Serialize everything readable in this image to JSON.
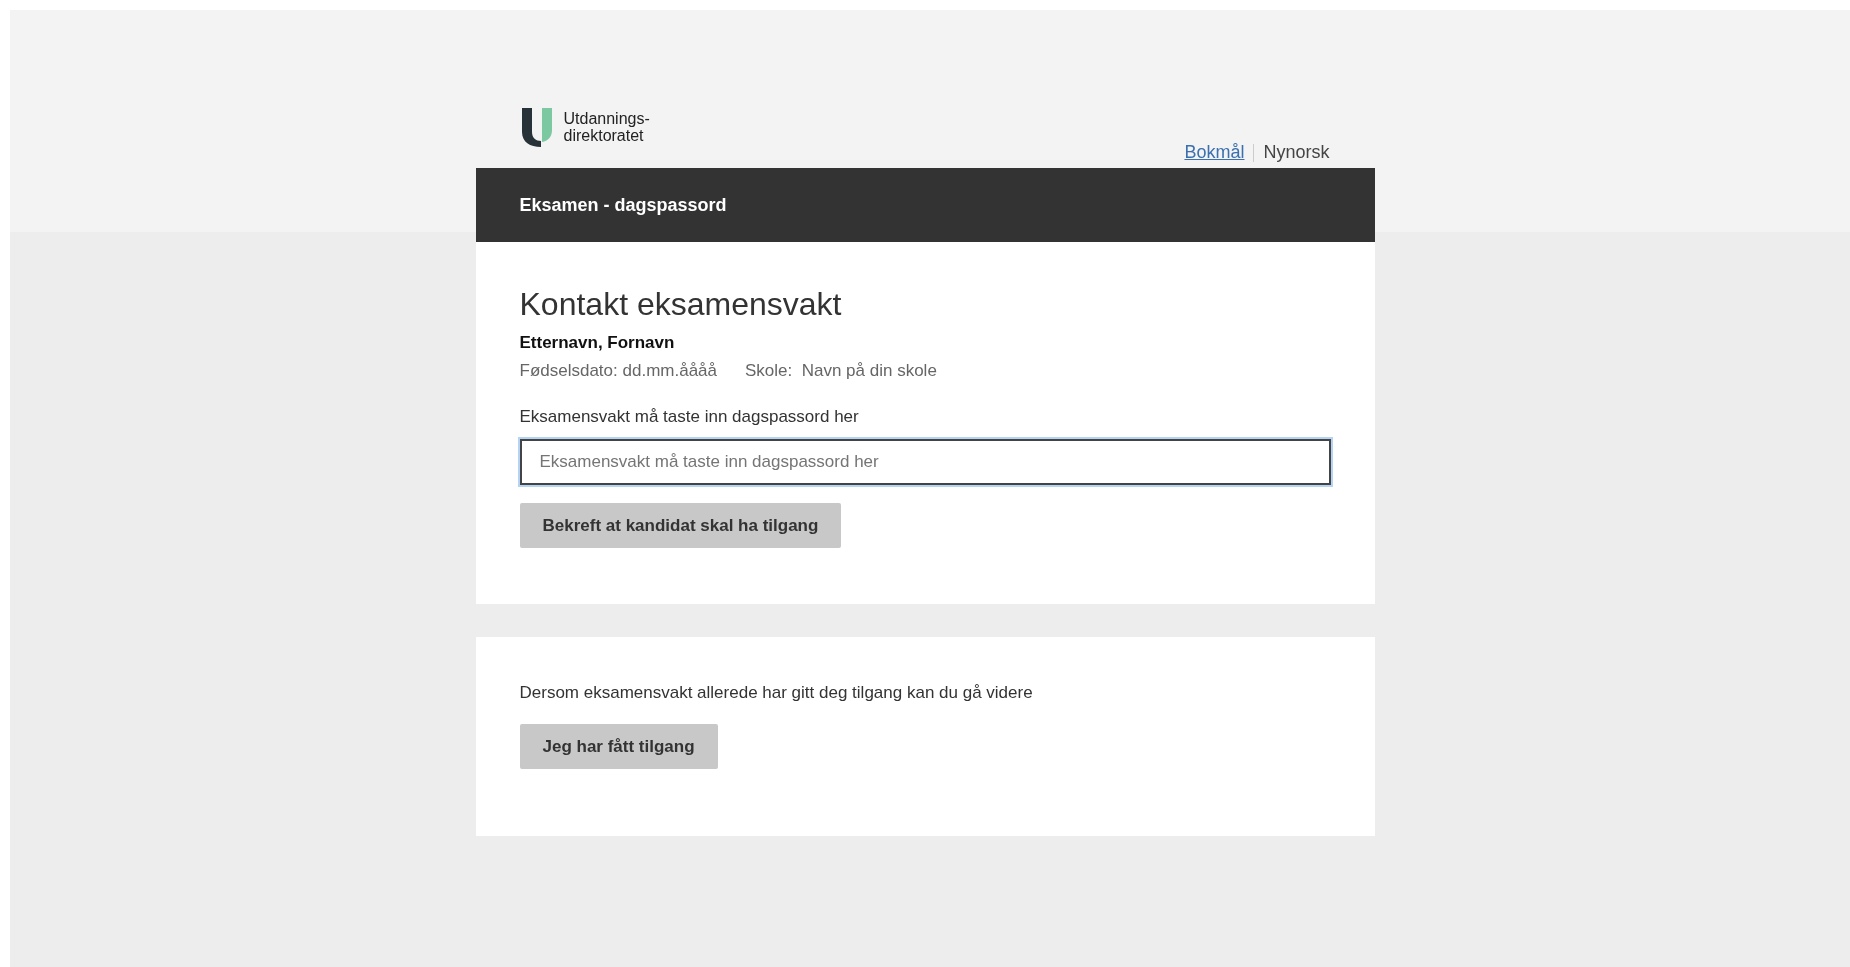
{
  "logo": {
    "line_1": "Utdannings-",
    "line_2": "direktoratet"
  },
  "languages": [
    {
      "label": "Bokmål",
      "selected": false
    },
    {
      "label": "Nynorsk",
      "selected": true
    }
  ],
  "header": {
    "title": "Eksamen - dagspassord"
  },
  "access_card": {
    "heading": "Kontakt eksamensvakt",
    "candidate_name": "Etternavn, Fornavn",
    "birth_date_label": "Fødselsdato:",
    "birth_date": "dd.mm.åååå",
    "school_label": "Skole:",
    "school": "Navn på din skole",
    "field_label": "Eksamensvakt må taste inn dagspassord her",
    "field": {
      "placeholder": "Eksamensvakt må taste inn dagspassord her",
      "focused": true
    },
    "button": "Bekreft at kandidat skal ha tilgang"
  },
  "continue_card": {
    "text": "Dersom eksamensvakt allerede har gitt deg tilgang kan du gå videre",
    "button": "Jeg har fått tilgang"
  }
}
